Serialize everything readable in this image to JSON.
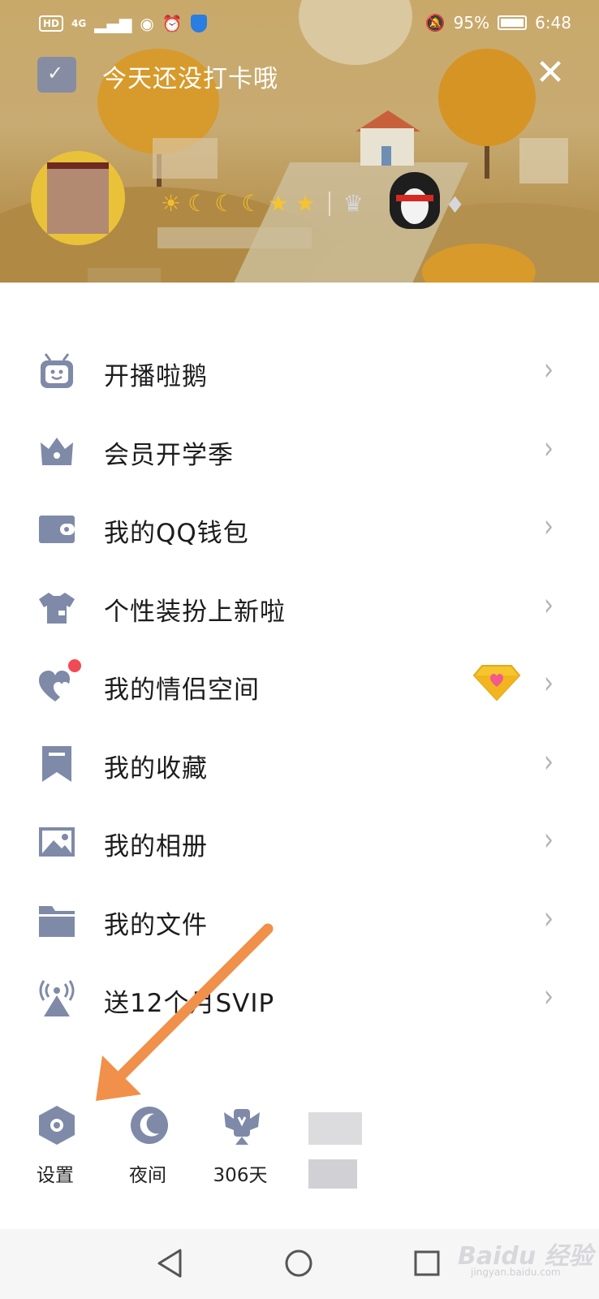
{
  "status_bar": {
    "hd": "HD",
    "network": "4G",
    "battery": "95%",
    "time": "6:48"
  },
  "header": {
    "checkin_text": "今天还没打卡哦"
  },
  "menu": [
    {
      "label": "开播啦鹅",
      "icon": "tv-robot-icon"
    },
    {
      "label": "会员开学季",
      "icon": "crown-icon"
    },
    {
      "label": "我的QQ钱包",
      "icon": "wallet-icon"
    },
    {
      "label": "个性装扮上新啦",
      "icon": "tshirt-icon"
    },
    {
      "label": "我的情侣空间",
      "icon": "hearts-icon"
    },
    {
      "label": "我的收藏",
      "icon": "bookmark-icon"
    },
    {
      "label": "我的相册",
      "icon": "image-icon"
    },
    {
      "label": "我的文件",
      "icon": "folder-icon"
    },
    {
      "label": "送12个月SVIP",
      "icon": "broadcast-icon"
    }
  ],
  "toolbar": {
    "settings": "设置",
    "night": "夜间",
    "days": "306天"
  },
  "watermark": {
    "main": "Baidu 经验",
    "sub": "jingyan.baidu.com"
  },
  "colors": {
    "icon_gray": "#7f8aa8",
    "chevron": "#b4b4b8",
    "arrow": "#f0904a",
    "red_dot": "#f24a55"
  }
}
